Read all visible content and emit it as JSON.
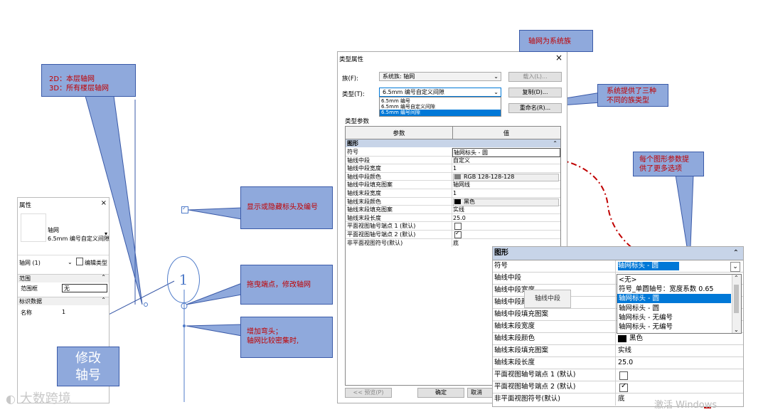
{
  "props_panel": {
    "title": "属性",
    "close": "×",
    "family_name": "轴网",
    "type_name": "6.5mm 编号自定义间隙",
    "instance_selector": "轴网 (1)",
    "edit_type": "编辑类型",
    "section_range": "范围",
    "range_box_label": "范围框",
    "range_box_value": "无",
    "section_identity": "标识数据",
    "name_label": "名称",
    "name_value": "1"
  },
  "callouts": {
    "dims": "2D：本层轴网\n3D：所有楼层轴网",
    "show_hide": "显示或隐藏标头及编号",
    "drag": "拖曳端点，修改轴网",
    "elbow": "增加弯头；\n轴网比较密集时,",
    "modify": "修改\n轴号",
    "system_family": "轴网为系统族",
    "three_types": "系统提供了三种\n不同的族类型",
    "more_options": "每个图形参数提\n供了更多选项"
  },
  "grid_bubble_number": "1",
  "watermark_logo": "大数跨境",
  "watermark_windows": "激活 Windows",
  "dialog": {
    "title": "类型属性",
    "close": "×",
    "family_label": "族(F):",
    "family_value": "系统族: 轴网",
    "load_button": "载入(L)...",
    "type_label": "类型(T):",
    "type_value": "6.5mm 编号自定义间隙",
    "duplicate_button": "复制(D)...",
    "rename_button": "重命名(R)...",
    "type_options": [
      "6.5mm 编号",
      "6.5mm 编号自定义间隙",
      "6.5mm 编号间隙"
    ],
    "type_params_label": "类型参数",
    "col_param": "参数",
    "col_value": "值",
    "group_graphics": "图形",
    "rows": [
      {
        "k": "符号",
        "v": "轴网标头 - 圆"
      },
      {
        "k": "轴线中段",
        "v": "自定义"
      },
      {
        "k": "轴线中段宽度",
        "v": "1"
      },
      {
        "k": "轴线中段颜色",
        "v": "RGB 128-128-128"
      },
      {
        "k": "轴线中段填充图案",
        "v": "轴网线"
      },
      {
        "k": "轴线末段宽度",
        "v": "1"
      },
      {
        "k": "轴线末段颜色",
        "v": "黑色"
      },
      {
        "k": "轴线末段填充图案",
        "v": "实线"
      },
      {
        "k": "轴线末段长度",
        "v": "25.0"
      },
      {
        "k": "平面视图轴号端点 1 (默认)",
        "v": ""
      },
      {
        "k": "平面视图轴号端点 2 (默认)",
        "v": ""
      },
      {
        "k": "非平面视图符号(默认)",
        "v": "底"
      }
    ],
    "preview_button": "<< 预览(P)",
    "ok_button": "确定",
    "cancel_button": "取消"
  },
  "zoom": {
    "group_graphics": "图形",
    "rows": [
      {
        "k": "符号",
        "v": "轴网标头 - 圆"
      },
      {
        "k": "轴线中段",
        "v": ""
      },
      {
        "k": "轴线中段宽度",
        "v": ""
      },
      {
        "k": "轴线中段颜色",
        "v": ""
      },
      {
        "k": "轴线中段填充图案",
        "v": ""
      },
      {
        "k": "轴线末段宽度",
        "v": ""
      },
      {
        "k": "轴线末段颜色",
        "v": "黑色"
      },
      {
        "k": "轴线末段填充图案",
        "v": "实线"
      },
      {
        "k": "轴线末段长度",
        "v": "25.0"
      },
      {
        "k": "平面视图轴号端点 1 (默认)",
        "v": ""
      },
      {
        "k": "平面视图轴号端点 2 (默认)",
        "v": ""
      },
      {
        "k": "非平面视图符号(默认)",
        "v": "底"
      }
    ],
    "tooltip": "轴线中段",
    "dropdown_options": [
      "<无>",
      "符号_单圆轴号：宽度系数 0.65",
      "轴网标头 - 圆",
      "轴网标头 - 圆",
      "轴网标头 - 无编号",
      "轴网标头 - 无编号"
    ]
  },
  "colors": {
    "callout_fill": "#8fa9dc",
    "callout_text": "#c00000",
    "select_blue": "#0078d7",
    "mid_color": "#808080"
  }
}
